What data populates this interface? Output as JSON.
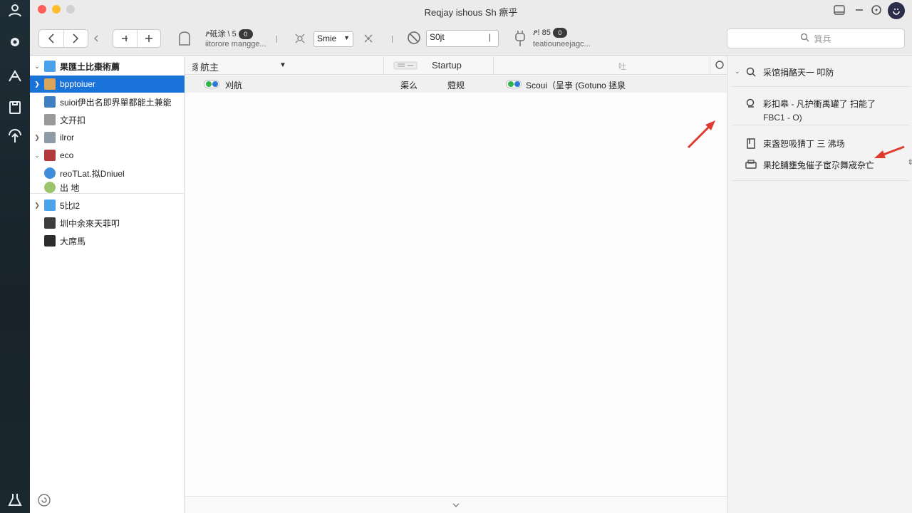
{
  "window": {
    "title": "Reqjay ishous Sh 瘵乎",
    "colors": {
      "close": "#ff5f57",
      "minimize": "#febc2e",
      "zoom": "#d1d1d1",
      "selection": "#1a73d9",
      "arrow": "#e03a2f"
    }
  },
  "toolbar": {
    "group1_label": "ፆ砥涂 \\ 5",
    "group1_badge": "0",
    "group1_sub": "iitorore mangge...",
    "select_value": "Smie",
    "field_value": "S0jt",
    "group2_label": "ፆ! 85",
    "group2_badge": "0",
    "group2_sub": "teatiouneejagc...",
    "search_placeholder": "箕兵"
  },
  "sidebar": {
    "items": [
      {
        "label": "果匯土比棗術薦"
      },
      {
        "label": "bpptoiuer"
      },
      {
        "label": "suioi伊出名即界單都能土兼能"
      },
      {
        "label": "文开扣"
      },
      {
        "label": "ilror"
      },
      {
        "label": "eco"
      },
      {
        "label": "reoTLat.拟Dniuel"
      },
      {
        "label": "出 地"
      },
      {
        "label": "5比l2"
      },
      {
        "label": "圳中余來天菲叩"
      },
      {
        "label": "大席馬"
      }
    ]
  },
  "main": {
    "columns": {
      "name": "豸航主",
      "type": "Startup",
      "other": "吐"
    },
    "row": {
      "name": "刈航",
      "col2": "渠么",
      "col3": "蒄规",
      "source": "Scoui（呈亊 (Gotuno 拯泉"
    }
  },
  "inspector": {
    "item1": "采馆捐酪天一 叩防",
    "item2_line1": "彩扣皋 - 凡护衝禹罐了 扫能了",
    "item2_line2": "FBC1 - O)",
    "item3": "束盏恕吸猜丁 三 沸场",
    "item4": "果抡脯壅兔催子宦尕舞宬杂亡"
  }
}
